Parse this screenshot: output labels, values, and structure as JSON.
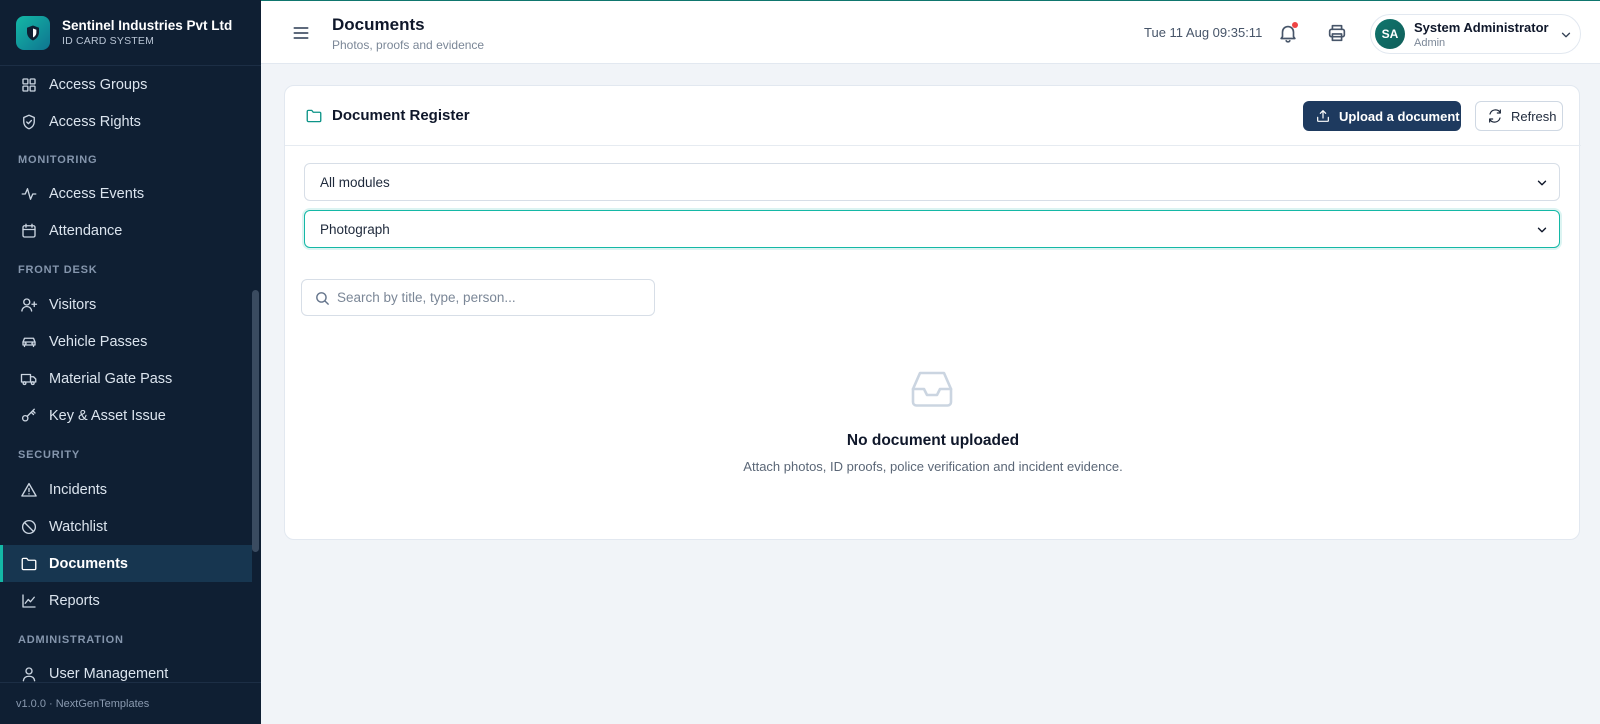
{
  "app": {
    "name": "Sentinel Industries Pvt Ltd",
    "subtitle": "ID CARD SYSTEM",
    "version": "v1.0.0 · NextGenTemplates",
    "accent": "#14b8a6",
    "sidebar_bg": "#0f1f33",
    "primary": "#1e3a5f"
  },
  "sidebar": {
    "items": [
      {
        "label": "Access Groups",
        "icon": "grid-icon"
      },
      {
        "label": "Access Rights",
        "icon": "shield-check-icon"
      },
      {
        "label": "Access Events",
        "icon": "activity-icon"
      },
      {
        "label": "Attendance",
        "icon": "calendar-icon"
      },
      {
        "label": "Visitors",
        "icon": "user-plus-icon"
      },
      {
        "label": "Vehicle Passes",
        "icon": "car-icon"
      },
      {
        "label": "Material Gate Pass",
        "icon": "truck-icon"
      },
      {
        "label": "Key & Asset Issue",
        "icon": "key-icon"
      },
      {
        "label": "Incidents",
        "icon": "alert-triangle-icon"
      },
      {
        "label": "Watchlist",
        "icon": "ban-icon"
      },
      {
        "label": "Documents",
        "icon": "folder-icon",
        "active": true
      },
      {
        "label": "Reports",
        "icon": "line-chart-icon"
      },
      {
        "label": "User Management",
        "icon": "user-icon"
      }
    ],
    "sections": {
      "monitoring": "MONITORING",
      "front_desk": "FRONT DESK",
      "security": "SECURITY",
      "administration": "ADMINISTRATION"
    }
  },
  "header": {
    "title": "Documents",
    "subtitle": "Photos, proofs and evidence",
    "datetime": "Tue 11 Aug 09:35:11",
    "user": {
      "initials": "SA",
      "name": "System Administrator",
      "role": "Admin"
    }
  },
  "card": {
    "title": "Document Register",
    "upload_label": "Upload a document",
    "refresh_label": "Refresh",
    "module_filter": {
      "value": "All modules"
    },
    "type_filter": {
      "value": "Photograph"
    },
    "search": {
      "placeholder": "Search by title, type, person...",
      "value": ""
    },
    "empty": {
      "title": "No document uploaded",
      "text": "Attach photos, ID proofs, police verification and incident evidence."
    }
  }
}
